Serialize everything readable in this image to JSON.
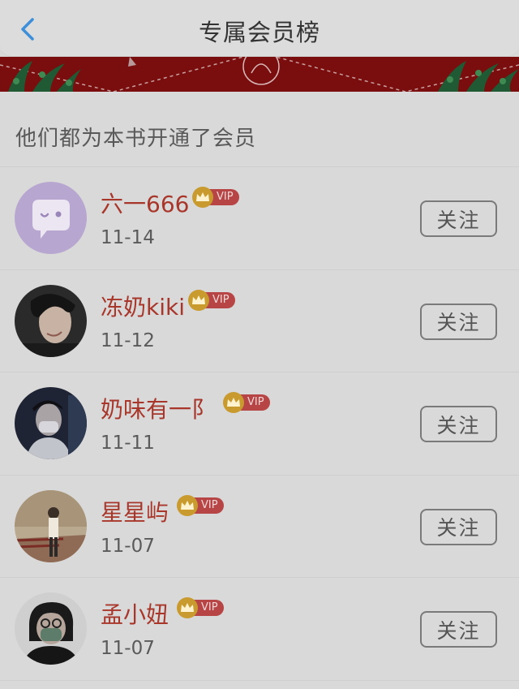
{
  "header": {
    "title": "专属会员榜"
  },
  "section": {
    "title": "他们都为本书开通了会员"
  },
  "vip_label": "VIP",
  "colors": {
    "name": "#a8362a",
    "vip_badge": "#b84545",
    "crown": "#c99a2e",
    "banner": "#7a0d0d"
  },
  "members": [
    {
      "name": "六一666",
      "date": "11-14",
      "follow_label": "关注",
      "avatar": "default-chat-avatar"
    },
    {
      "name": "冻奶kiki",
      "date": "11-12",
      "follow_label": "关注",
      "avatar": "user-photo"
    },
    {
      "name": "奶味有一阝",
      "date": "11-11",
      "follow_label": "关注",
      "avatar": "user-photo"
    },
    {
      "name": "星星屿",
      "date": "11-07",
      "follow_label": "关注",
      "avatar": "user-photo"
    },
    {
      "name": "孟小妞",
      "date": "11-07",
      "follow_label": "关注",
      "avatar": "user-photo"
    }
  ]
}
